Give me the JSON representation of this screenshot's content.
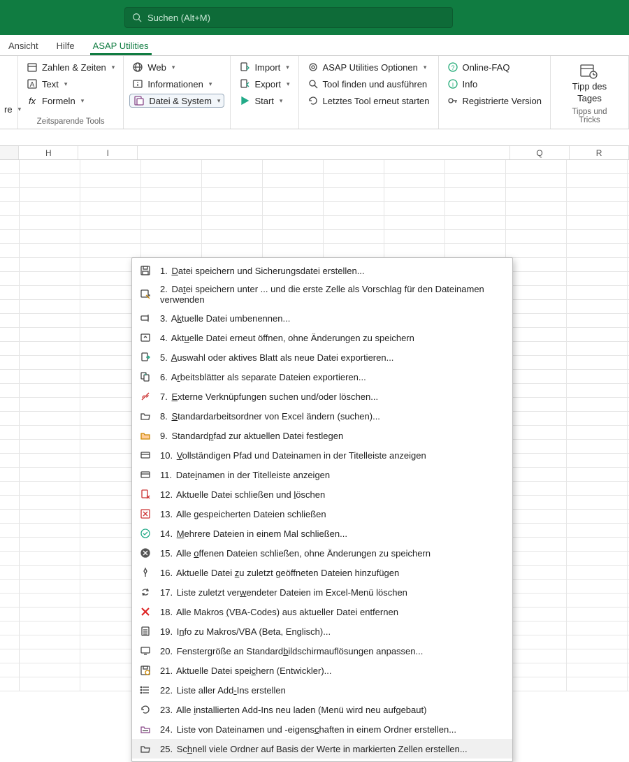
{
  "search": {
    "placeholder": "Suchen (Alt+M)"
  },
  "tabs": [
    {
      "label": "Ansicht"
    },
    {
      "label": "Hilfe"
    },
    {
      "label": "ASAP Utilities",
      "active": true
    }
  ],
  "ribbon": {
    "group1": {
      "label": "Zeitsparende Tools",
      "truncated": "re",
      "btns": {
        "zahlen": "Zahlen & Zeiten",
        "text": "Text",
        "formeln": "Formeln"
      }
    },
    "group2": {
      "btns": {
        "web": "Web",
        "informationen": "Informationen",
        "datei_system": "Datei & System"
      }
    },
    "group3": {
      "btns": {
        "import": "Import",
        "export": "Export",
        "start": "Start"
      }
    },
    "group4": {
      "btns": {
        "optionen": "ASAP Utilities Optionen",
        "finden": "Tool finden und ausführen",
        "letztes": "Letztes Tool erneut starten"
      }
    },
    "group5": {
      "btns": {
        "faq": "Online-FAQ",
        "info": "Info",
        "reg": "Registrierte Version"
      }
    },
    "tip": {
      "line1": "Tipp des",
      "line2": "Tages",
      "group_label": "Tipps und Tricks"
    }
  },
  "columns": [
    "H",
    "I",
    "",
    "",
    "",
    "",
    "",
    "Q",
    "R"
  ],
  "menu": {
    "items": [
      {
        "num": "1.",
        "pre": "",
        "key": "D",
        "post": "atei speichern und Sicherungsdatei erstellen...",
        "icon": "save"
      },
      {
        "num": "2.",
        "pre": "Da",
        "key": "t",
        "post": "ei speichern unter ... und die erste Zelle als Vorschlag für den Dateinamen verwenden",
        "icon": "save-as"
      },
      {
        "num": "3.",
        "pre": "A",
        "key": "k",
        "post": "tuelle Datei umbenennen...",
        "icon": "rename"
      },
      {
        "num": "4.",
        "pre": "Akt",
        "key": "u",
        "post": "elle Datei erneut öffnen, ohne Änderungen zu speichern",
        "icon": "reopen"
      },
      {
        "num": "5.",
        "pre": "",
        "key": "A",
        "post": "uswahl oder aktives Blatt als neue Datei exportieren...",
        "icon": "export-sheet"
      },
      {
        "num": "6.",
        "pre": "A",
        "key": "r",
        "post": "beitsblätter als separate Dateien exportieren...",
        "icon": "export-multi"
      },
      {
        "num": "7.",
        "pre": "",
        "key": "E",
        "post": "xterne Verknüpfungen suchen und/oder löschen...",
        "icon": "link-break"
      },
      {
        "num": "8.",
        "pre": "",
        "key": "S",
        "post": "tandardarbeitsordner von Excel ändern (suchen)...",
        "icon": "folder-open"
      },
      {
        "num": "9.",
        "pre": "Standard",
        "key": "p",
        "post": "fad zur aktuellen Datei festlegen",
        "icon": "folder-set"
      },
      {
        "num": "10.",
        "pre": "",
        "key": "V",
        "post": "ollständigen Pfad und Dateinamen in der Titelleiste anzeigen",
        "icon": "titlebar"
      },
      {
        "num": "11.",
        "pre": "Date",
        "key": "i",
        "post": "namen in der Titelleiste anzeigen",
        "icon": "titlebar"
      },
      {
        "num": "12.",
        "pre": "Aktuelle Datei schließen und ",
        "key": "l",
        "post": "öschen",
        "icon": "close-delete"
      },
      {
        "num": "13.",
        "pre": "Alle ",
        "key": "g",
        "post": "espeicherten Dateien schließen",
        "icon": "close-x"
      },
      {
        "num": "14.",
        "pre": "",
        "key": "M",
        "post": "ehrere Dateien in einem Mal schließen...",
        "icon": "close-ok"
      },
      {
        "num": "15.",
        "pre": "Alle ",
        "key": "o",
        "post": "ffenen Dateien schließen, ohne Änderungen zu speichern",
        "icon": "close-dark"
      },
      {
        "num": "16.",
        "pre": "Aktuelle Datei ",
        "key": "z",
        "post": "u zuletzt geöffneten Dateien hinzufügen",
        "icon": "pin"
      },
      {
        "num": "17.",
        "pre": "Liste zuletzt ver",
        "key": "w",
        "post": "endeter Dateien im Excel-Menü löschen",
        "icon": "recycle"
      },
      {
        "num": "18.",
        "pre": "Alle Makros ",
        "key": "(",
        "post": "VBA-Codes) aus aktueller Datei entfernen",
        "icon": "x-red"
      },
      {
        "num": "19.",
        "pre": "I",
        "key": "n",
        "post": "fo zu Makros/VBA (Beta, Englisch)...",
        "icon": "calc"
      },
      {
        "num": "20.",
        "pre": "Fenstergröße an Standard",
        "key": "b",
        "post": "ildschirmauflösungen anpassen...",
        "icon": "screen"
      },
      {
        "num": "21.",
        "pre": "Aktuelle Datei spei",
        "key": "c",
        "post": "hern (Entwickler)...",
        "icon": "save-dev"
      },
      {
        "num": "22.",
        "pre": "Liste aller Add",
        "key": "-",
        "post": "Ins erstellen",
        "icon": "list"
      },
      {
        "num": "23.",
        "pre": "Alle ",
        "key": "i",
        "post": "nstallierten Add-Ins neu laden (Menü wird neu aufgebaut)",
        "icon": "reload"
      },
      {
        "num": "24.",
        "pre": "Liste von Dateinamen und -eigens",
        "key": "c",
        "post": "haften in einem Ordner erstellen...",
        "icon": "folder-list"
      },
      {
        "num": "25.",
        "pre": "Sc",
        "key": "h",
        "post": "nell viele Ordner auf Basis der Werte in markierten Zellen erstellen...",
        "icon": "folder-open",
        "hovered": true
      }
    ]
  }
}
